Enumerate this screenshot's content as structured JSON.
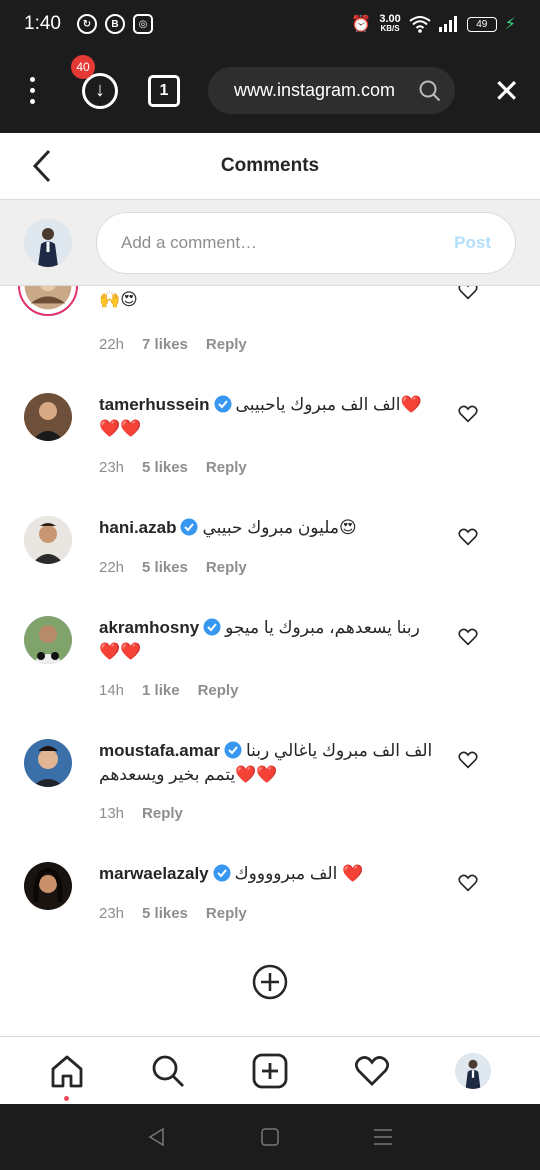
{
  "status_bar": {
    "time": "1:40",
    "speed_value": "3.00",
    "speed_unit": "KB/S",
    "battery": "49"
  },
  "browser": {
    "download_badge": "40",
    "tab_count": "1",
    "url": "www.instagram.com"
  },
  "header": {
    "title": "Comments"
  },
  "compose": {
    "placeholder": "Add a comment…",
    "post_label": "Post"
  },
  "colors": {
    "accent": "#0095f6",
    "verified": "#3897f0",
    "heart_red": "#ed2a2a",
    "story_ring": "#e1306c"
  },
  "comments": [
    {
      "user": "",
      "text": "🙌😍",
      "time": "22h",
      "likes": "7 likes",
      "reply": "Reply"
    },
    {
      "user": "tamerhussein",
      "text": "الف الف مبروك ياحبيبى❤️❤️❤️",
      "time": "23h",
      "likes": "5 likes",
      "reply": "Reply"
    },
    {
      "user": "hani.azab",
      "text": "مليون مبروك حبيبي😍",
      "time": "22h",
      "likes": "5 likes",
      "reply": "Reply"
    },
    {
      "user": "akramhosny",
      "text": "ربنا يسعدهم، مبروك يا ميجو❤️❤️",
      "time": "14h",
      "likes": "1 like",
      "reply": "Reply"
    },
    {
      "user": "moustafa.amar",
      "text": "الف الف مبروك ياغالي ربنا يتمم بخير ويسعدهم❤️❤️",
      "time": "13h",
      "likes": "",
      "reply": "Reply"
    },
    {
      "user": "marwaelazaly",
      "text": "الف مبرووووك ❤️",
      "time": "23h",
      "likes": "5 likes",
      "reply": "Reply"
    }
  ]
}
